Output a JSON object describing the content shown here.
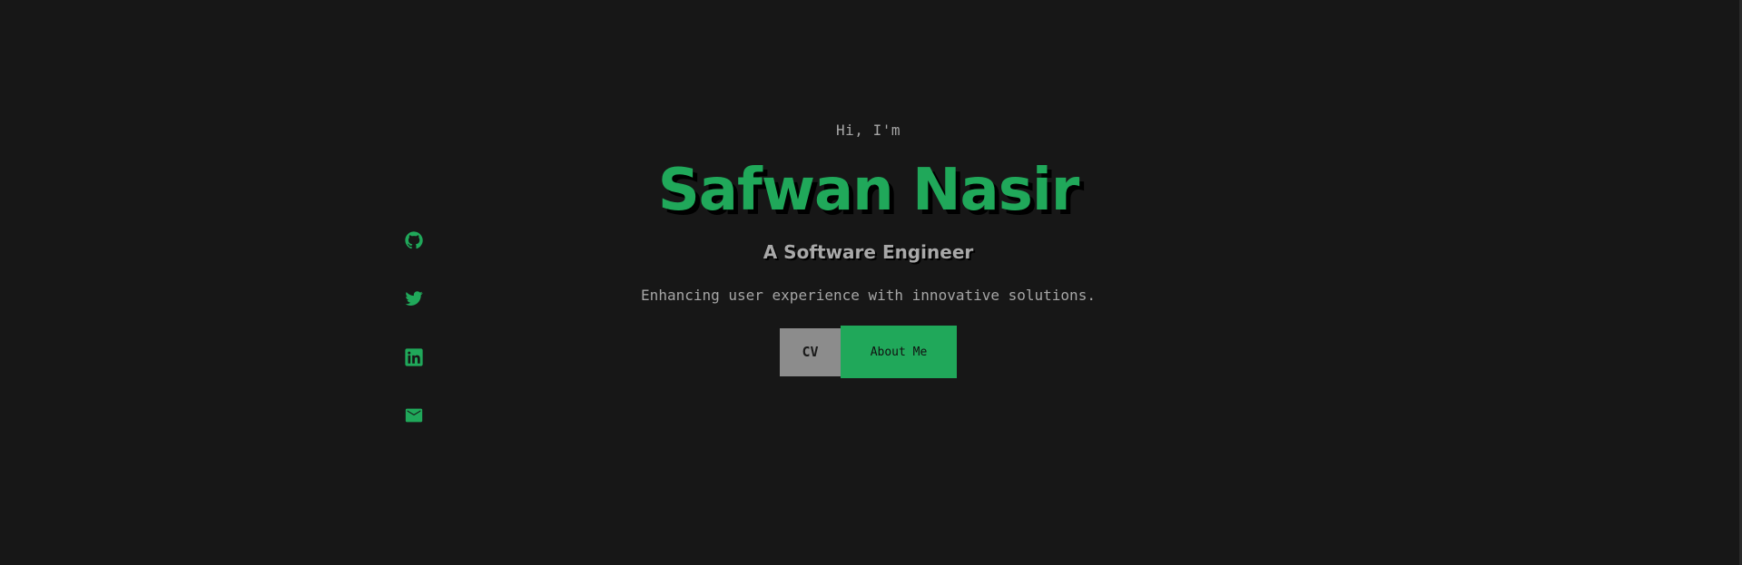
{
  "hero": {
    "greeting": "Hi, I'm",
    "name": "Safwan Nasir",
    "role": "A Software Engineer",
    "tagline": "Enhancing user experience with innovative solutions."
  },
  "actions": {
    "cv_label": "CV",
    "about_label": "About Me"
  },
  "socials": [
    {
      "icon": "github-icon"
    },
    {
      "icon": "twitter-icon"
    },
    {
      "icon": "linkedin-icon"
    },
    {
      "icon": "email-icon"
    }
  ],
  "colors": {
    "background": "#171717",
    "accent": "#20a85a",
    "muted_text": "#a6a6a6",
    "cv_button": "#8c8c8c"
  }
}
